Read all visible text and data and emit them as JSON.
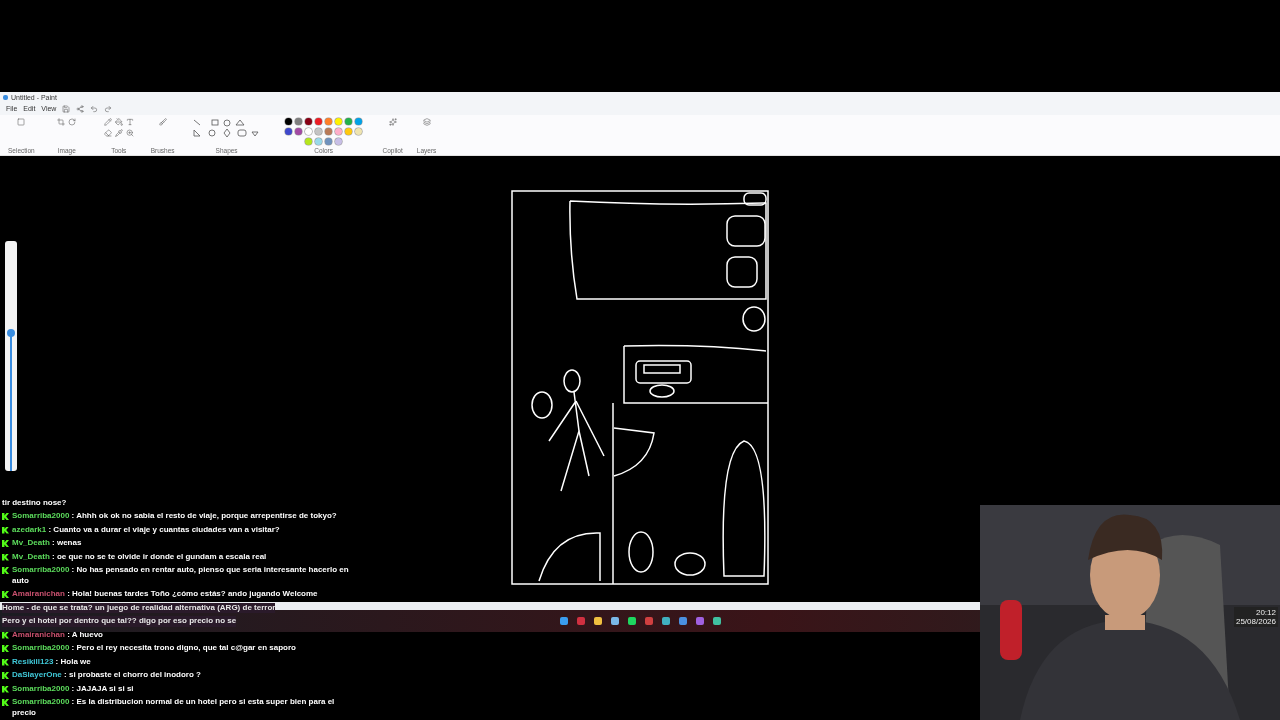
{
  "window": {
    "title": "Untitled - Paint"
  },
  "menu": [
    "File",
    "Edit",
    "View"
  ],
  "ribbon": {
    "groups": [
      {
        "label": "Selection"
      },
      {
        "label": "Image"
      },
      {
        "label": "Tools"
      },
      {
        "label": "Brushes"
      },
      {
        "label": "Shapes"
      },
      {
        "label": "Colors"
      },
      {
        "label": "Copilot"
      },
      {
        "label": "Layers"
      }
    ],
    "swatches": [
      {
        "color": "#000000"
      },
      {
        "color": "#7f7f7f"
      },
      {
        "color": "#880015"
      },
      {
        "color": "#ed1c24"
      },
      {
        "color": "#ff7f27"
      },
      {
        "color": "#fff200"
      },
      {
        "color": "#22b14c"
      },
      {
        "color": "#00a2e8"
      },
      {
        "color": "#3f48cc"
      },
      {
        "color": "#a349a4"
      },
      {
        "color": "#ffffff"
      },
      {
        "color": "#c3c3c3"
      },
      {
        "color": "#b97a57"
      },
      {
        "color": "#ffaec9"
      },
      {
        "color": "#ffc90e"
      },
      {
        "color": "#efe4b0"
      },
      {
        "color": "#b5e61d"
      },
      {
        "color": "#99d9ea"
      },
      {
        "color": "#7092be"
      },
      {
        "color": "#c8bfe7"
      }
    ]
  },
  "canvas": {
    "zoom_slider": {
      "level": 0.6
    }
  },
  "chat": [
    {
      "kind": "continuation",
      "text": "tir destino nose?"
    },
    {
      "kind": "message",
      "user": "Somarriba2000",
      "color": "#5cdc5c",
      "text": ": Ahhh ok ok no sabia el resto de viaje, porque arrepentirse de tokyo?"
    },
    {
      "kind": "message",
      "user": "azedark1",
      "color": "#5cdc5c",
      "text": ": Cuanto va a durar el viaje y cuantas ciudades van a visitar?"
    },
    {
      "kind": "message",
      "user": "Mv_Death",
      "color": "#5cdc5c",
      "text": ": wenas"
    },
    {
      "kind": "message",
      "user": "Mv_Death",
      "color": "#5cdc5c",
      "text": ": oe que no se te olvide ir donde el gundam a escala real"
    },
    {
      "kind": "message",
      "user": "Somarriba2000",
      "color": "#5cdc5c",
      "text": ": No has pensado en rentar auto, pienso que seria interesante hacerlo en auto"
    },
    {
      "kind": "message",
      "user": "Amairanichan",
      "color": "#c8506e",
      "text": ": Hola! buenas tardes Toño ¿cómo estás? ando jugando Welcome"
    },
    {
      "kind": "obscured",
      "text": "Home - de que se trata? un juego de realidad alternativa (ARG) de terror"
    },
    {
      "kind": "obscured",
      "text": "Pero y el hotel por dentro que tal?? digo por eso precio no se"
    },
    {
      "kind": "message",
      "user": "Amairanichan",
      "color": "#c8506e",
      "text": ": A huevo"
    },
    {
      "kind": "message",
      "user": "Somarriba2000",
      "color": "#5cdc5c",
      "text": ": Pero el rey necesita trono digno, que tal c@gar en saporo"
    },
    {
      "kind": "message",
      "user": "Resikill123",
      "color": "#40c8d8",
      "text": ": Hola we"
    },
    {
      "kind": "message",
      "user": "DaSlayerOne",
      "color": "#40c8d8",
      "text": ": si probaste el chorro del inodoro ?"
    },
    {
      "kind": "message",
      "user": "Somarriba2000",
      "color": "#5cdc5c",
      "text": ": JAJAJA si si si"
    },
    {
      "kind": "message",
      "user": "Somarriba2000",
      "color": "#5cdc5c",
      "text": ": Es la distribucion normal de un hotel pero si esta super bien para el precio"
    }
  ],
  "taskbar": {
    "time": "20:12",
    "date": "25/08/2026"
  }
}
